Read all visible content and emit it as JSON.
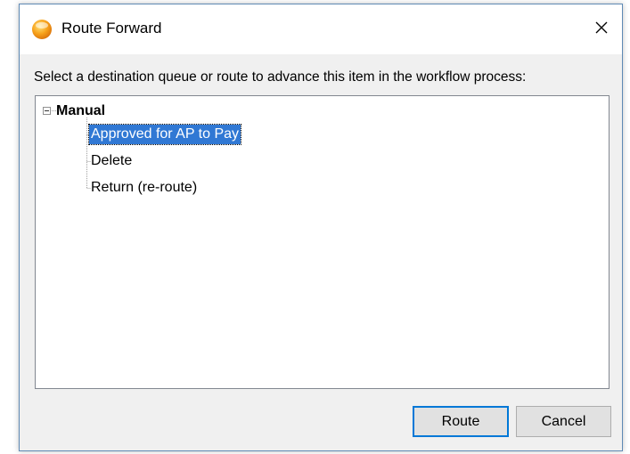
{
  "window": {
    "title": "Route Forward",
    "icon": "orange-orb-icon",
    "close_icon": "close-icon"
  },
  "instruction": "Select a destination queue or route to advance this item in the workflow process:",
  "tree": {
    "root": {
      "label": "Manual",
      "expanded": true
    },
    "children": [
      {
        "label": "Approved for AP to Pay",
        "selected": true
      },
      {
        "label": "Delete",
        "selected": false
      },
      {
        "label": "Return (re-route)",
        "selected": false
      }
    ]
  },
  "buttons": {
    "route_label": "Route",
    "cancel_label": "Cancel"
  },
  "colors": {
    "selection": "#3078d4",
    "default_button_border": "#0078d7",
    "dialog_background": "#f0f0f0",
    "icon_orange": "#f7a21b"
  }
}
